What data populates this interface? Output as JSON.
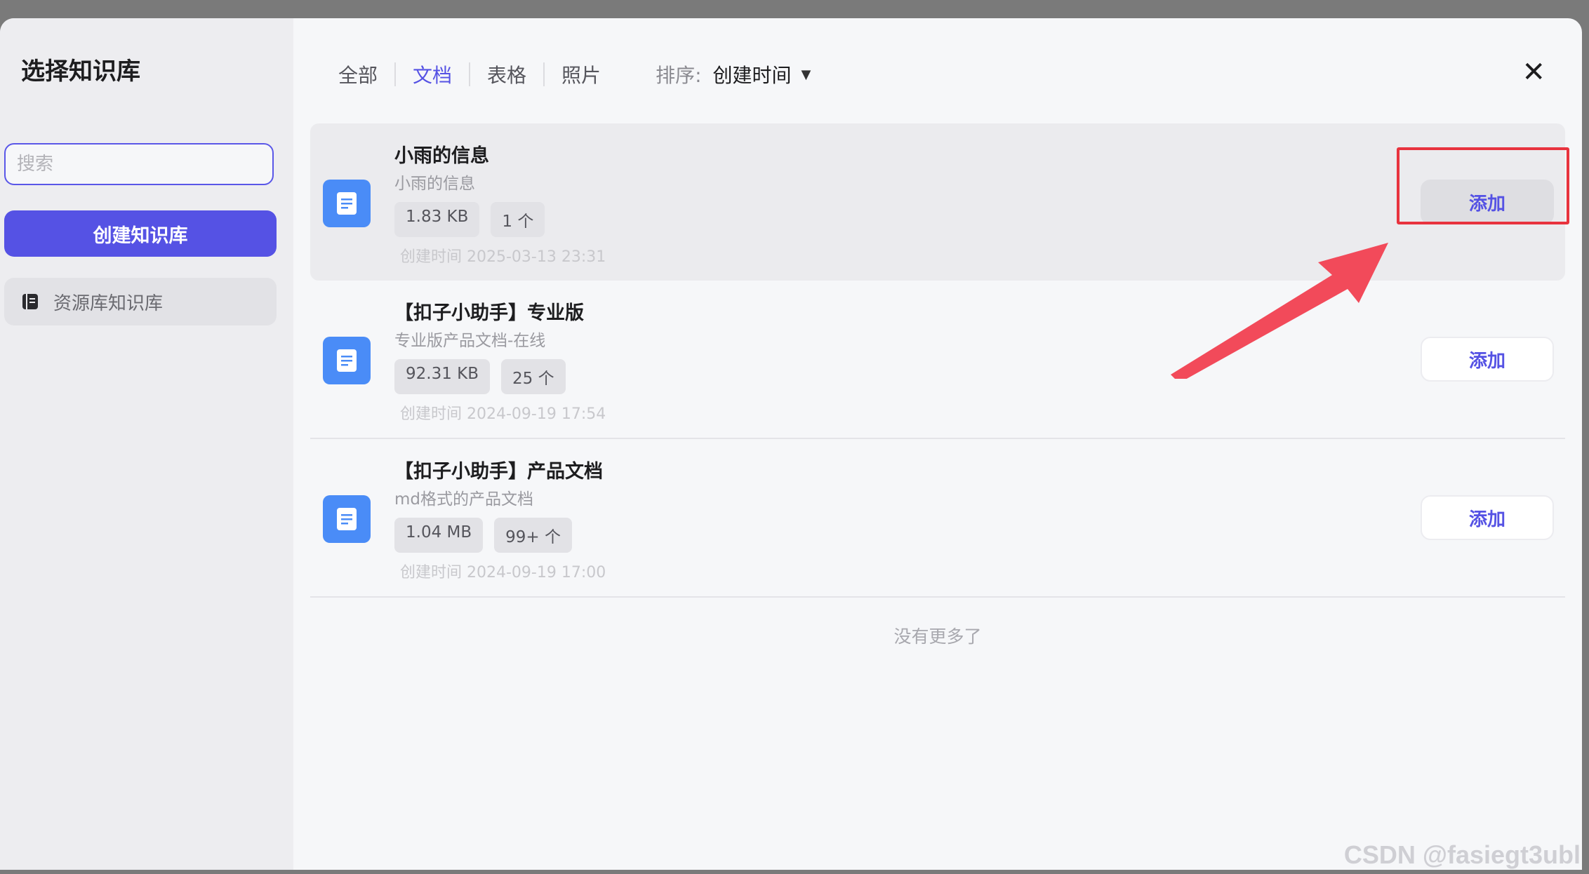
{
  "sidebar": {
    "title": "选择知识库",
    "search_placeholder": "搜索",
    "create_label": "创建知识库",
    "library_label": "资源库知识库"
  },
  "tabs": [
    {
      "label": "全部",
      "active": false
    },
    {
      "label": "文档",
      "active": true
    },
    {
      "label": "表格",
      "active": false
    },
    {
      "label": "照片",
      "active": false
    }
  ],
  "sort": {
    "label": "排序:",
    "value": "创建时间"
  },
  "items": [
    {
      "title": "小雨的信息",
      "desc": "小雨的信息",
      "size": "1.83 KB",
      "count": "1 个",
      "time": "创建时间 2025-03-13 23:31",
      "add": "添加"
    },
    {
      "title": "【扣子小助手】专业版",
      "desc": "专业版产品文档-在线",
      "size": "92.31 KB",
      "count": "25 个",
      "time": "创建时间 2024-09-19 17:54",
      "add": "添加"
    },
    {
      "title": "【扣子小助手】产品文档",
      "desc": "md格式的产品文档",
      "size": "1.04 MB",
      "count": "99+ 个",
      "time": "创建时间 2024-09-19 17:00",
      "add": "添加"
    }
  ],
  "footer": {
    "no_more": "没有更多了"
  },
  "watermark": "CSDN @fasiegt3ubl",
  "colors": {
    "accent": "#5552e4",
    "doc_icon": "#4a8cf7",
    "annotation": "#e8333e"
  }
}
